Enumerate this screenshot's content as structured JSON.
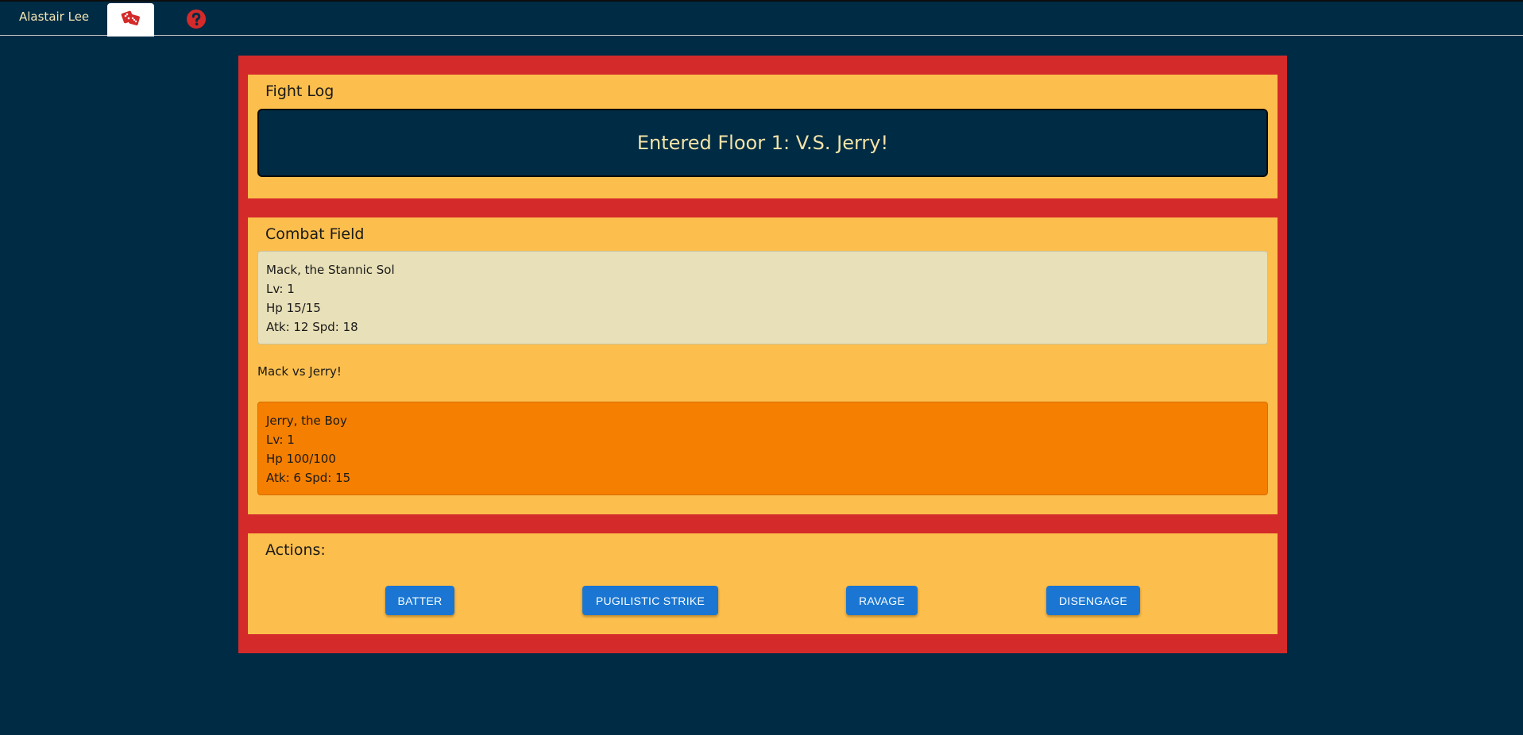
{
  "header": {
    "user_name": "Alastair Lee",
    "tabs": [
      {
        "icon": "dice-icon",
        "active": true
      },
      {
        "icon": "help-icon",
        "active": false
      }
    ]
  },
  "colors": {
    "background": "#002b45",
    "arena_border": "#d42a2a",
    "panel": "#fcbe4c",
    "player_card": "#e8e0b8",
    "enemy_card": "#f57f00",
    "button": "#1a76d2",
    "icon_red": "#d42a2a"
  },
  "fight_log": {
    "title": "Fight Log",
    "message": "Entered Floor 1: V.S. Jerry!"
  },
  "combat_field": {
    "title": "Combat Field",
    "player": {
      "name": "Mack, the Stannic Sol",
      "level": "Lv: 1",
      "hp": "Hp 15/15",
      "stats": "Atk: 12 Spd: 18"
    },
    "versus": "Mack vs Jerry!",
    "enemy": {
      "name": "Jerry, the Boy",
      "level": "Lv: 1",
      "hp": "Hp 100/100",
      "stats": "Atk: 6 Spd: 15"
    }
  },
  "actions": {
    "title": "Actions:",
    "buttons": [
      {
        "label": "BATTER"
      },
      {
        "label": "PUGILISTIC STRIKE"
      },
      {
        "label": "RAVAGE"
      },
      {
        "label": "DISENGAGE"
      }
    ]
  }
}
